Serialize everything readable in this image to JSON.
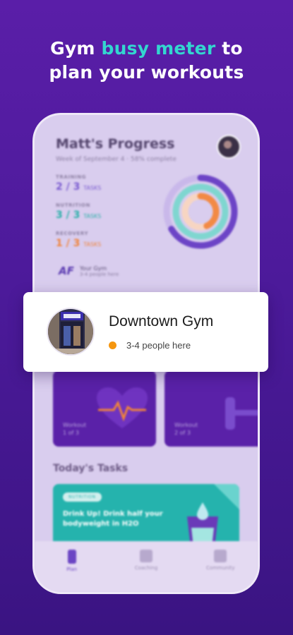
{
  "headline": {
    "line1_before": "Gym ",
    "line1_accent": "busy meter",
    "line1_after": " to",
    "line2": "plan your workouts"
  },
  "phone": {
    "title": "Matt's Progress",
    "subtitle": "Week of September 4 · 58% complete",
    "stats": [
      {
        "label": "TRAINING",
        "value": "2 / 3",
        "unit": "TASKS",
        "color": "#7a5bd0"
      },
      {
        "label": "NUTRITION",
        "value": "3 / 3",
        "unit": "TASKS",
        "color": "#2bb0a9"
      },
      {
        "label": "RECOVERY",
        "value": "1 / 3",
        "unit": "TASKS",
        "color": "#f0843a"
      }
    ],
    "your_gym": {
      "logo": "AF",
      "label": "Your Gym",
      "status": "3-4 people here"
    },
    "cards": [
      {
        "label_line1": "Workout",
        "label_line2": "1 of 3"
      },
      {
        "label_line1": "Workout",
        "label_line2": "2 of 3"
      }
    ],
    "tasks_title": "Today's Tasks",
    "task": {
      "tag": "NUTRITION",
      "text": "Drink Up! Drink half your bodyweight in H2O"
    },
    "tabs": [
      {
        "label": "Plan",
        "icon": "clipboard-icon"
      },
      {
        "label": "Coaching",
        "icon": "chat-icon"
      },
      {
        "label": "Community",
        "icon": "community-icon"
      }
    ]
  },
  "gym_card": {
    "name": "Downtown Gym",
    "status_text": "3-4 people here",
    "status_color": "#f5960f"
  },
  "colors": {
    "background": "#4c1a9a",
    "accent": "#33d6cf",
    "card_purple": "#5a21a8",
    "task_teal": "#25b3ad"
  }
}
